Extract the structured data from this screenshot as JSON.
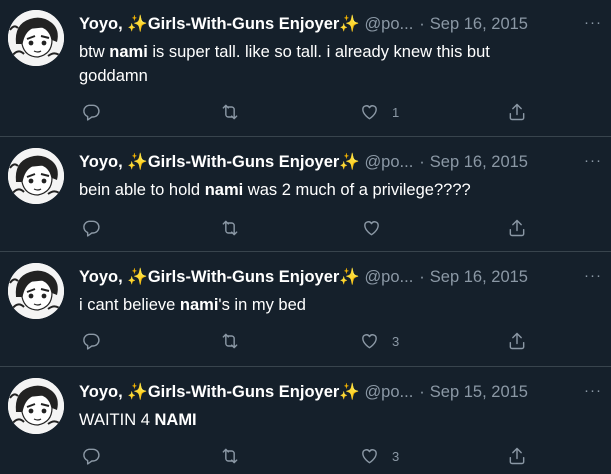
{
  "colors": {
    "background": "#15202b",
    "text": "#ffffff",
    "secondary": "#8b98a5",
    "divider": "#38444d",
    "sparkle": "#f4c93c"
  },
  "icons": {
    "reply": "reply-icon",
    "retweet": "retweet-icon",
    "like": "heart-icon",
    "share": "share-icon",
    "more": "more-icon",
    "sparkle": "sparkles-emoji"
  },
  "author": {
    "name_prefix": "Yoyo, ",
    "sparkle": "✨",
    "name_mid": "Girls-With-Guns Enjoyer",
    "handle": "@po...",
    "more": "···"
  },
  "tweets": [
    {
      "date": "Sep 16, 2015",
      "text_parts": [
        "btw ",
        "nami",
        " is super tall. like so tall. i already knew this but goddamn"
      ],
      "likes": "1"
    },
    {
      "date": "Sep 16, 2015",
      "text_parts": [
        "bein able to hold ",
        "nami",
        " was 2 much of a privilege????"
      ],
      "likes": ""
    },
    {
      "date": "Sep 16, 2015",
      "text_parts": [
        "i cant believe ",
        "nami",
        "'s in my bed"
      ],
      "likes": "3"
    },
    {
      "date": "Sep 15, 2015",
      "text_parts": [
        "WAITIN 4 ",
        "NAMI",
        ""
      ],
      "likes": "3"
    }
  ]
}
